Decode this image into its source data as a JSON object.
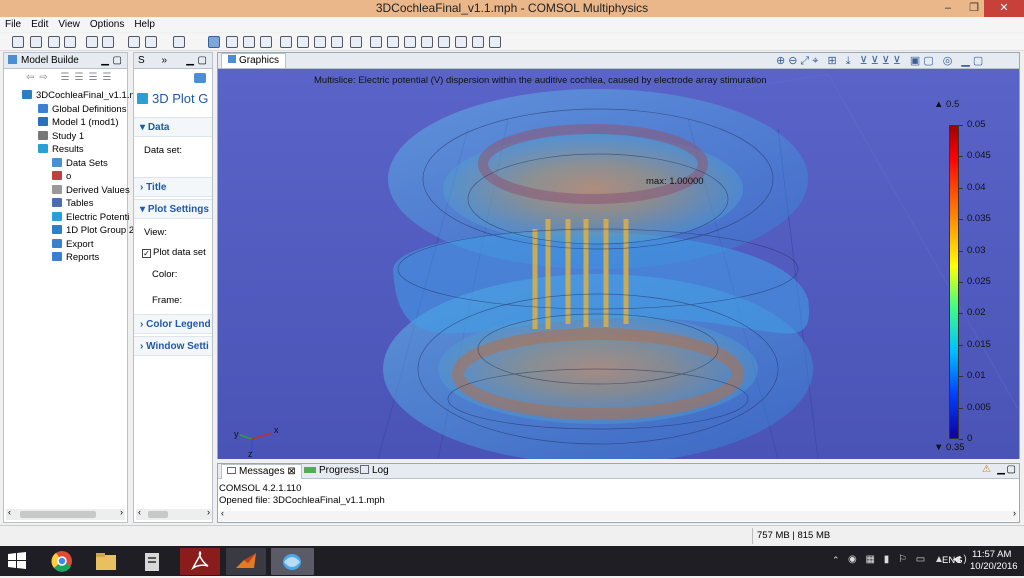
{
  "window": {
    "title": "3DCochleaFinal_v1.1.mph - COMSOL Multiphysics",
    "minimize": "–",
    "maximize": "❐",
    "close": "✕"
  },
  "menu": [
    "File",
    "Edit",
    "View",
    "Options",
    "Help"
  ],
  "model_builder": {
    "tab": "Model Builde",
    "items": [
      {
        "label": "3DCochleaFinal_v1.1.m",
        "icon": "model-root-icon",
        "color": "#2a7fc8"
      },
      {
        "label": "Global Definitions",
        "icon": "global-definitions-icon",
        "color": "#3d7fd0"
      },
      {
        "label": "Model 1 (mod1)",
        "icon": "model-icon",
        "color": "#2a6fb8"
      },
      {
        "label": "Study 1",
        "icon": "study-icon",
        "color": "#777"
      },
      {
        "label": "Results",
        "icon": "results-icon",
        "color": "#2a9fd6"
      },
      {
        "label": "Data Sets",
        "icon": "data-sets-icon",
        "color": "#4a8fd6"
      },
      {
        "label": "o",
        "icon": "derived-icon",
        "color": "#c04040"
      },
      {
        "label": "Derived Values",
        "icon": "derived-values-icon",
        "color": "#999"
      },
      {
        "label": "Tables",
        "icon": "tables-icon",
        "color": "#4a6fb0"
      },
      {
        "label": "Electric Potenti",
        "icon": "plot-group-3d-icon",
        "color": "#2a9fd6"
      },
      {
        "label": "1D Plot Group 2",
        "icon": "plot-group-1d-icon",
        "color": "#2a7fc8"
      },
      {
        "label": "Export",
        "icon": "export-icon",
        "color": "#3a7fd0"
      },
      {
        "label": "Reports",
        "icon": "reports-icon",
        "color": "#3a7fd0"
      }
    ]
  },
  "settings": {
    "tab": "S",
    "tab2": "»",
    "heading": "3D Plot G",
    "sections": {
      "data": "Data",
      "title": "Title",
      "plot_settings": "Plot Settings",
      "color_legend": "Color Legend",
      "window_settings": "Window Setti"
    },
    "data_set_label": "Data set:",
    "view_label": "View:",
    "plot_data_set": "Plot data set",
    "color_label": "Color:",
    "frame_label": "Frame:"
  },
  "graphics": {
    "tab": "Graphics",
    "plot_title": "Multislice: Electric potential (V) dispersion within  the auditive cochlea, caused by electrode array stimuration",
    "max_label": "max: 1.00000",
    "axis_x": "x",
    "axis_y": "y",
    "axis_z": "z"
  },
  "legend": {
    "top_arrow": "▲ 0.5",
    "bottom_arrow": "▼ 0.35",
    "ticks": [
      "0.05",
      "0.045",
      "0.04",
      "0.035",
      "0.03",
      "0.025",
      "0.02",
      "0.015",
      "0.01",
      "0.005",
      "0"
    ]
  },
  "messages": {
    "tabs": [
      "Messages",
      "Progress",
      "Log"
    ],
    "lines": [
      "COMSOL 4.2.1.110",
      "Opened file: 3DCochleaFinal_v1.1.mph"
    ]
  },
  "status": {
    "memory": "757 MB | 815 MB"
  },
  "taskbar": {
    "lang": "ENG",
    "time": "11:57 AM",
    "date": "10/20/2016"
  }
}
